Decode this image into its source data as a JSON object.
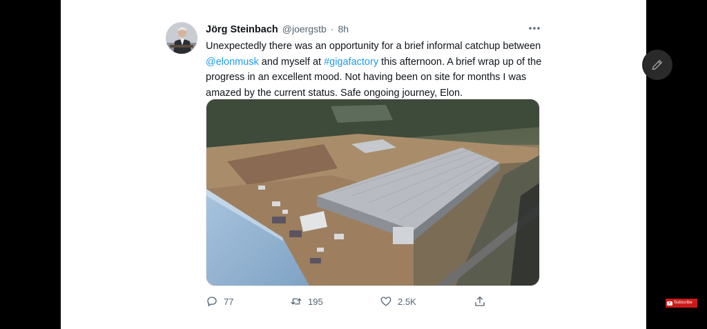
{
  "tweet": {
    "author": {
      "name": "Jörg Steinbach",
      "handle": "@joergstb",
      "separator": "·",
      "time": "8h"
    },
    "text": {
      "part1": "Unexpectedly there was an opportunity for a brief informal catchup between ",
      "mention": "@elonmusk",
      "part2": " and myself at ",
      "hashtag": "#gigafactory",
      "part3": " this afternoon. A brief wrap up of the progress in an excellent mood. Not having been on site for months I was amazed by the current status. Safe ongoing journey, Elon."
    },
    "more_icon": "more-horizontal-icon",
    "media": {
      "icon": "aerial-factory-photo"
    },
    "actions": {
      "reply_count": "77",
      "retweet_count": "195",
      "like_count": "2.5K",
      "reply_icon": "reply-icon",
      "retweet_icon": "retweet-icon",
      "like_icon": "heart-icon",
      "share_icon": "share-icon"
    }
  },
  "overlay": {
    "edit_icon": "pencil-icon",
    "subscribe_label": "Subscribe"
  },
  "colors": {
    "link": "#1d9bf0",
    "text": "#0f1419",
    "secondary": "#536471",
    "subscribe": "#cc1a1a"
  }
}
